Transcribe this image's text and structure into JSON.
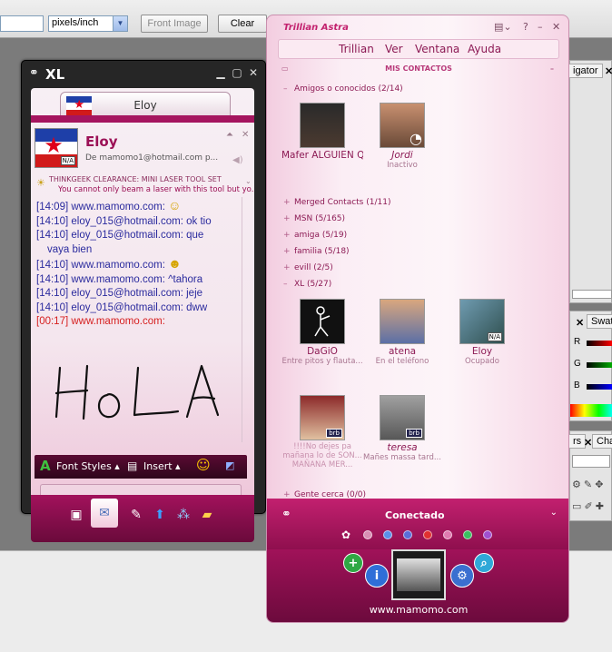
{
  "photoshop": {
    "units_value": "pixels/inch",
    "front_image_label": "Front Image",
    "clear_label": "Clear",
    "navigator_tab": "igator",
    "swatches_tab": "Swat",
    "channels_tab": "Cha",
    "rs_label": "rs",
    "color_channels": [
      "R",
      "G",
      "B"
    ]
  },
  "xl_window": {
    "title": "XL",
    "tab_name": "Eloy",
    "contact_name": "Eloy",
    "contact_email": "De mamomo1@hotmail.com p...",
    "avatar_badge": "N/A",
    "promo_title": "THINKGEEK CLEARANCE: MINI LASER TOOL SET",
    "promo_text": "You cannot only beam a laser with this tool but yo...",
    "messages": [
      {
        "time": "[14:09]",
        "sender": "www.mamomo.com:",
        "text": "",
        "emoji": "☺"
      },
      {
        "time": "[14:10]",
        "sender": "eloy_015@hotmail.com:",
        "text": "ok tio",
        "emoji": ""
      },
      {
        "time": "[14:10]",
        "sender": "eloy_015@hotmail.com:",
        "text": "que",
        "emoji": ""
      },
      {
        "time": "",
        "sender": "",
        "text": "vaya bien",
        "emoji": ""
      },
      {
        "time": "[14:10]",
        "sender": "www.mamomo.com:",
        "text": "",
        "emoji": "☻"
      },
      {
        "time": "[14:10]",
        "sender": "www.mamomo.com:",
        "text": "^tahora",
        "emoji": ""
      },
      {
        "time": "[14:10]",
        "sender": "eloy_015@hotmail.com:",
        "text": "jeje",
        "emoji": ""
      },
      {
        "time": "[14:10]",
        "sender": "eloy_015@hotmail.com:",
        "text": "dww",
        "emoji": ""
      },
      {
        "time": "[00:17]",
        "sender": "www.mamomo.com:",
        "text": "",
        "emoji": ""
      }
    ],
    "toolbar": {
      "font_styles": "Font Styles",
      "insert": "Insert"
    }
  },
  "trillian": {
    "logo": "Trillian Astra",
    "menu": [
      "Trillian",
      "Ver",
      "Ventana",
      "Ayuda"
    ],
    "section_title": "MIS CONTACTOS",
    "groups": {
      "amigos": "Amigos o conocidos (2/14)",
      "merged": "Merged Contacts (1/11)",
      "msn": "MSN (5/165)",
      "amiga": "amiga (5/19)",
      "familia": "familia (5/18)",
      "evill": "evill (2/5)",
      "xl": "XL (5/27)",
      "gente": "Gente cerca (0/0)"
    },
    "contacts_amigos": [
      {
        "name": "Mafer ALGUIEN QUI...",
        "status": ""
      },
      {
        "name": "Jordi",
        "status": "Inactivo"
      }
    ],
    "contacts_xl": [
      {
        "name": "DaGiO",
        "status": "Entre pitos y flauta..."
      },
      {
        "name": "atena",
        "status": "En el teléfono"
      },
      {
        "name": "Eloy",
        "status": "Ocupado"
      },
      {
        "name": "!!!!No dejes pa mañana lo de SON... MAÑANA MER...",
        "status": ""
      },
      {
        "name": "teresa",
        "status": "Mañes massa tard..."
      }
    ],
    "status_label": "Conectado",
    "url": "www.mamomo.com",
    "colors": {
      "accent": "#c2206f",
      "dark": "#6b0a3c"
    }
  }
}
